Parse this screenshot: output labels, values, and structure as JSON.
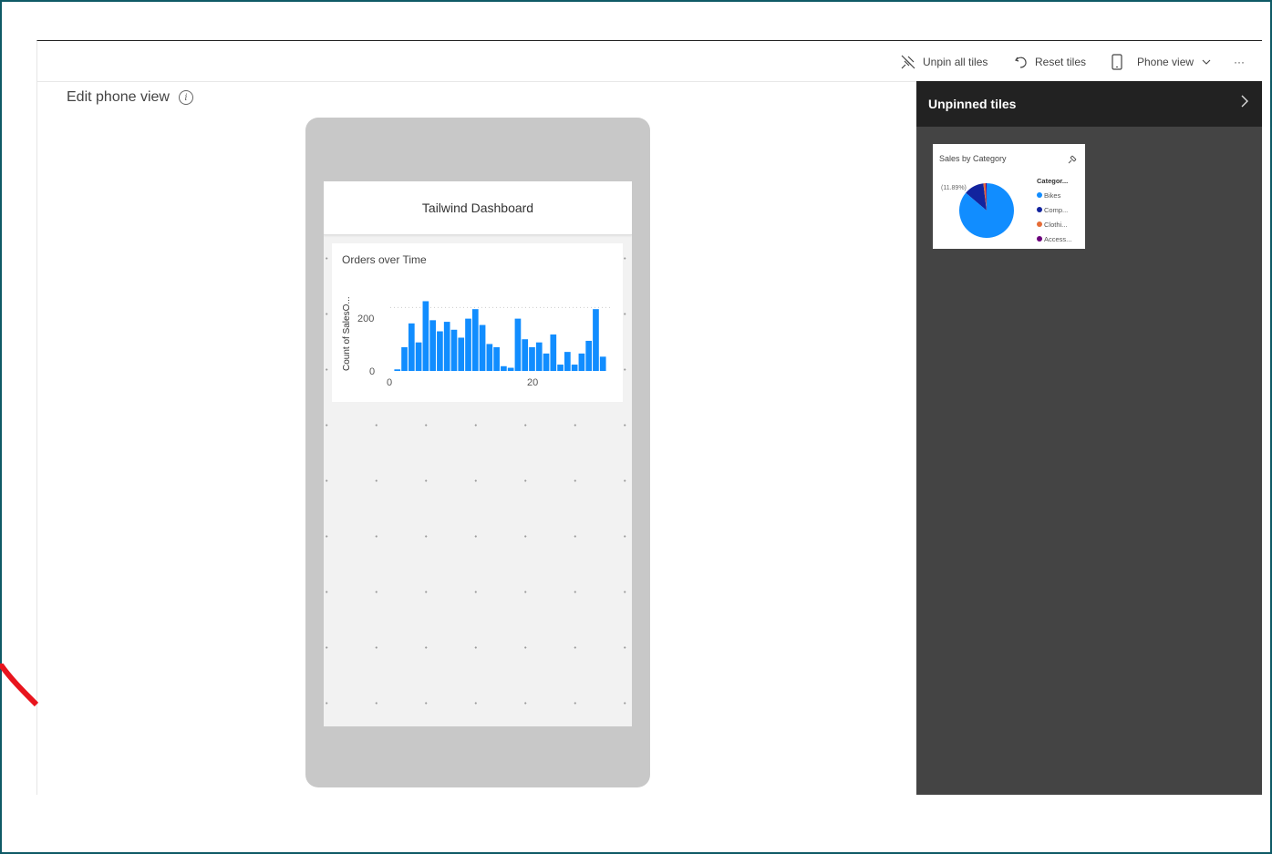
{
  "toolbar": {
    "unpin_all": "Unpin all tiles",
    "reset": "Reset tiles",
    "phone_view": "Phone view",
    "more": "···"
  },
  "edit_view": {
    "title": "Edit phone view",
    "info_icon": "info-icon"
  },
  "phone": {
    "dashboard_title": "Tailwind Dashboard",
    "tile": {
      "title": "Orders over Time",
      "y_axis_label": "Count of SalesO...",
      "y_ticks": [
        "200",
        "0"
      ],
      "x_ticks": [
        "0",
        "20"
      ]
    }
  },
  "unpinned_panel": {
    "title": "Unpinned tiles",
    "tile": {
      "title": "Sales by Category",
      "pct_label": "(11.89%)",
      "legend_title": "Categor...",
      "legend": [
        {
          "label": "Bikes",
          "color": "#118dff"
        },
        {
          "label": "Comp...",
          "color": "#12239e"
        },
        {
          "label": "Clothi...",
          "color": "#e66c37"
        },
        {
          "label": "Access...",
          "color": "#6b007b"
        }
      ]
    }
  },
  "colors": {
    "bar": "#118dff",
    "panel_bg": "#444444",
    "panel_header": "#222222",
    "frame": "#0f5a66"
  },
  "chart_data": [
    {
      "type": "bar",
      "title": "Orders over Time",
      "ylabel": "Count of SalesO...",
      "x": [
        1,
        2,
        3,
        4,
        5,
        6,
        7,
        8,
        9,
        10,
        11,
        12,
        13,
        14,
        15,
        16,
        17,
        18,
        19,
        20,
        21,
        22,
        23,
        24,
        25,
        26,
        27,
        28,
        29,
        30,
        31
      ],
      "values": [
        5,
        75,
        150,
        90,
        220,
        160,
        125,
        155,
        130,
        105,
        165,
        195,
        145,
        85,
        75,
        15,
        10,
        165,
        100,
        75,
        90,
        55,
        115,
        20,
        60,
        20,
        55,
        95,
        195,
        45
      ],
      "xticks": [
        0,
        20
      ],
      "yticks": [
        0,
        200
      ],
      "ylim": [
        0,
        230
      ],
      "xlim": [
        0,
        31
      ]
    },
    {
      "type": "pie",
      "title": "Sales by Category",
      "categories": [
        "Bikes",
        "Comp...",
        "Clothi...",
        "Access..."
      ],
      "values": [
        86.2,
        11.89,
        1.3,
        0.61
      ]
    }
  ]
}
